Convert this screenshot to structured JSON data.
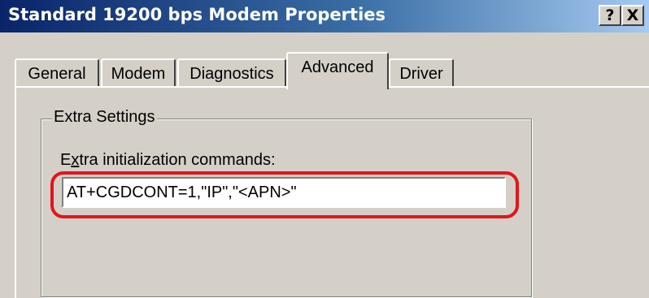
{
  "window": {
    "title": "Standard 19200 bps Modem Properties",
    "help_label": "?",
    "close_label": "X"
  },
  "tabs": [
    {
      "label": "General",
      "active": false
    },
    {
      "label": "Modem",
      "active": false
    },
    {
      "label": "Diagnostics",
      "active": false
    },
    {
      "label": "Advanced",
      "active": true
    },
    {
      "label": "Driver",
      "active": false
    }
  ],
  "extra_settings": {
    "group_label": "Extra Settings",
    "field_label_prefix": "E",
    "field_label_accel": "x",
    "field_label_rest": "tra initialization commands:",
    "command_value": "AT+CGDCONT=1,\"IP\",\"<APN>\""
  },
  "colors": {
    "titlebar_start": "#0a246a",
    "titlebar_end": "#a6caf0",
    "face": "#d4d0c8",
    "highlight_annotation": "#e4141d"
  }
}
